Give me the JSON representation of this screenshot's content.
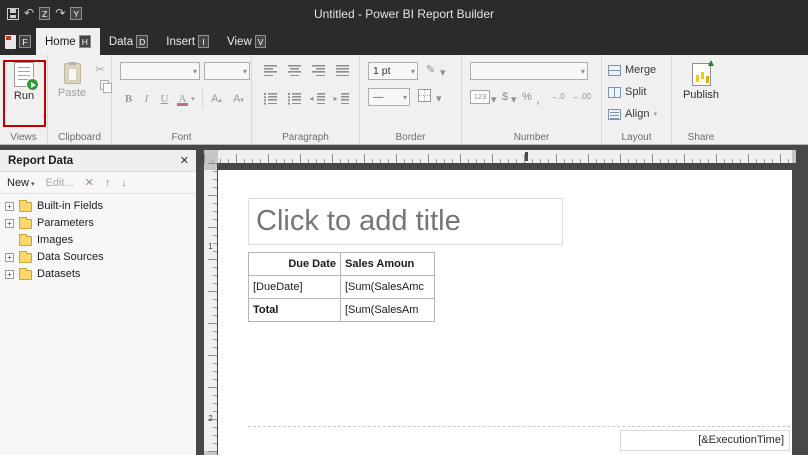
{
  "colors": {
    "callout_red": "#c00000",
    "run_green": "#2e9b2e",
    "titlebar": "#2b2b2b",
    "ribbon_bg": "#f0f0f0"
  },
  "title_bar": {
    "title": "Untitled - Power BI Report Builder"
  },
  "quick_access": {
    "undo_keytip": "Z",
    "redo_keytip": "Y"
  },
  "ribbon_tabs": {
    "file_keytip": "F",
    "tabs": [
      {
        "label": "Home",
        "keytip": "H"
      },
      {
        "label": "Data",
        "keytip": "D"
      },
      {
        "label": "Insert",
        "keytip": "I"
      },
      {
        "label": "View",
        "keytip": "V"
      }
    ]
  },
  "ribbon": {
    "views": {
      "label": "Views",
      "run_label": "Run"
    },
    "clipboard": {
      "label": "Clipboard",
      "paste_label": "Paste"
    },
    "font": {
      "label": "Font",
      "bold": "B",
      "italic": "I",
      "underline": "U",
      "fontcolor": "A",
      "grow": "A",
      "shrink": "A"
    },
    "paragraph": {
      "label": "Paragraph"
    },
    "border": {
      "label": "Border",
      "width_value": "1 pt"
    },
    "number": {
      "label": "Number",
      "format_label": "123",
      "dollar": "$",
      "percent": "%",
      "comma": ","
    },
    "layout": {
      "label": "Layout",
      "merge_label": "Merge",
      "split_label": "Split",
      "align_label": "Align"
    },
    "share": {
      "label": "Share",
      "publish_label": "Publish"
    }
  },
  "report_data_pane": {
    "title": "Report Data",
    "toolbar": {
      "new_label": "New",
      "edit_label": "Edit..."
    },
    "tree": [
      {
        "label": "Built-in Fields"
      },
      {
        "label": "Parameters"
      },
      {
        "label": "Images"
      },
      {
        "label": "Data Sources"
      },
      {
        "label": "Datasets"
      }
    ]
  },
  "canvas": {
    "title_placeholder": "Click to add title",
    "table": {
      "headers": [
        "Due Date",
        "Sales Amoun"
      ],
      "rows": [
        [
          "[DueDate]",
          "[Sum(SalesAmc"
        ],
        [
          "Total",
          "[Sum(SalesAm"
        ]
      ]
    },
    "footer_textbox": "[&ExecutionTime]"
  },
  "ruler": {
    "v_numbers": [
      "1",
      "2"
    ]
  }
}
